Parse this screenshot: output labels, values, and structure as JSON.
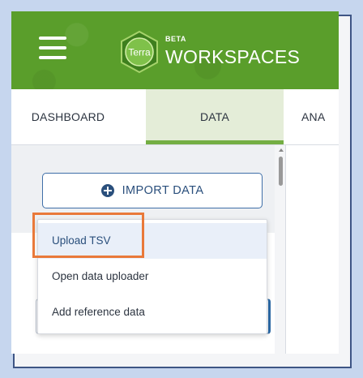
{
  "header": {
    "beta_label": "BETA",
    "brand_logo_text": "Terra",
    "app_title": "WORKSPACES"
  },
  "tabs": [
    {
      "label": "DASHBOARD",
      "active": false
    },
    {
      "label": "DATA",
      "active": true
    },
    {
      "label": "ANA",
      "active": false
    }
  ],
  "sidebar": {
    "import_button_label": "IMPORT DATA",
    "import_icon": "plus-circle-icon"
  },
  "import_menu": {
    "items": [
      {
        "label": "Upload TSV",
        "selected": true
      },
      {
        "label": "Open data uploader",
        "selected": false
      },
      {
        "label": "Add reference data",
        "selected": false
      }
    ]
  },
  "colors": {
    "brand_green": "#5a9e2b",
    "active_tab_underline": "#74ae43",
    "primary_blue": "#2a4f7c",
    "highlight_orange": "#e9793a",
    "page_background": "#c6d6ee",
    "frame_border": "#3e5585"
  }
}
